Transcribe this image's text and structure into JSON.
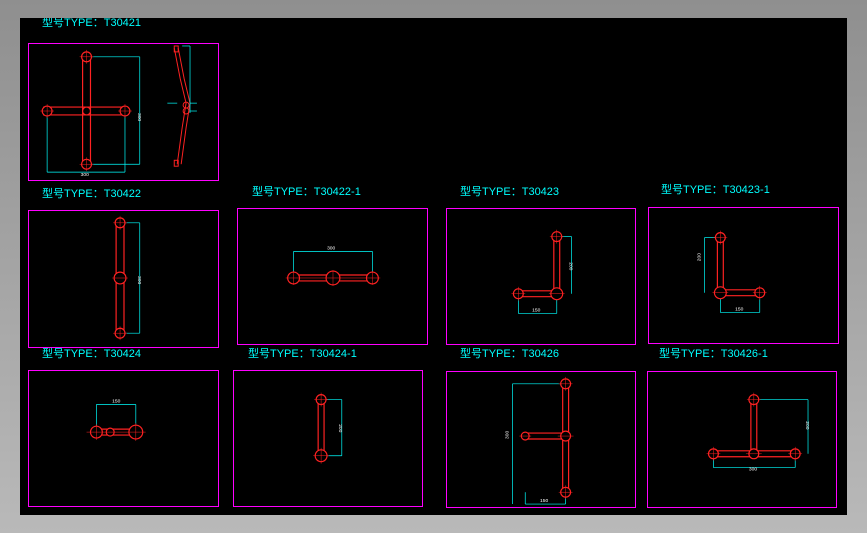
{
  "titles": {
    "t30421": "型号TYPE：T30421",
    "t30422": "型号TYPE：T30422",
    "t30422_1": "型号TYPE：T30422-1",
    "t30423": "型号TYPE：T30423",
    "t30423_1": "型号TYPE：T30423-1",
    "t30424": "型号TYPE：T30424",
    "t30424_1": "型号TYPE：T30424-1",
    "t30426": "型号TYPE：T30426",
    "t30426_1": "型号TYPE：T30426-1"
  },
  "colors": {
    "background": "#000000",
    "frame": "#ff00ff",
    "title": "#00ffff",
    "part": "#ff2222",
    "dimension": "#00ffff"
  }
}
